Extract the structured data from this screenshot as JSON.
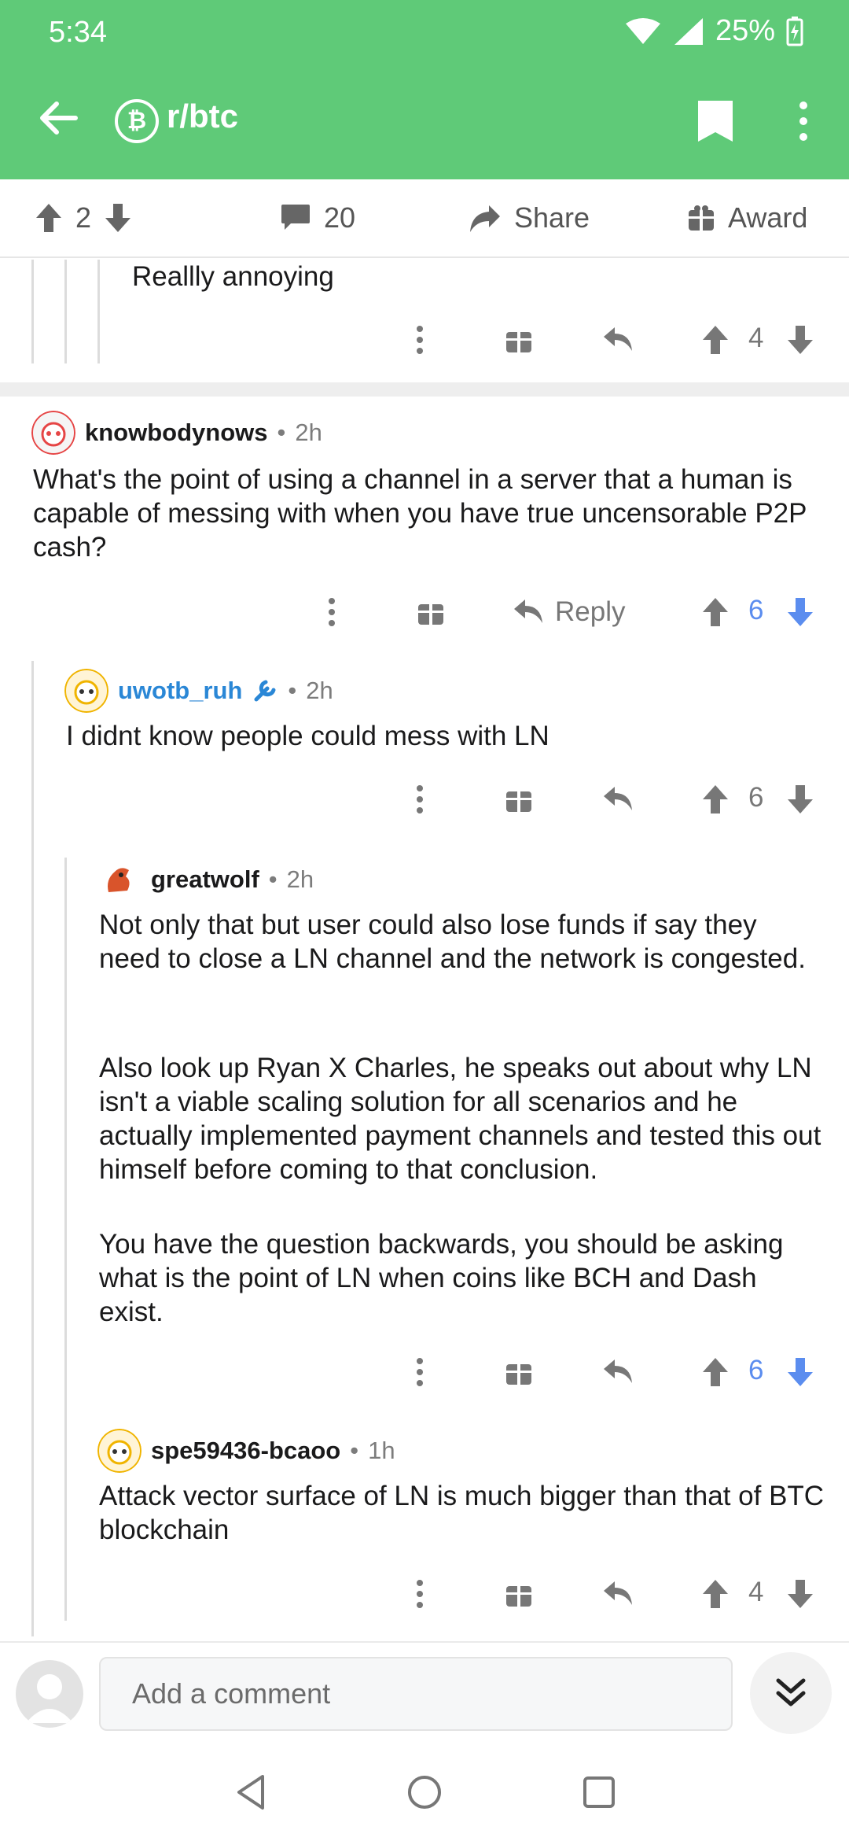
{
  "status": {
    "time": "5:34",
    "battery": "25%"
  },
  "header": {
    "subreddit": "r/btc",
    "sub_icon_glyph": "₿"
  },
  "actionbar": {
    "upvotes": "2",
    "comments": "20",
    "share": "Share",
    "award": "Award"
  },
  "comments": [
    {
      "text": "Reallly annoying",
      "score": "4"
    },
    {
      "author": "knowbodynows",
      "age": "2h",
      "text": "What's the point of using a channel in a server that a human is capable of messing with when you have true uncensorable P2P cash?",
      "reply_label": "Reply",
      "score": "6"
    },
    {
      "author": "uwotb_ruh",
      "age": "2h",
      "text": "I didnt know people could mess with LN",
      "score": "6"
    },
    {
      "author": "greatwolf",
      "age": "2h",
      "paragraphs": [
        "Not only that but user could also lose funds if say they need to close a LN channel and the network is congested.",
        "Also look up Ryan X Charles, he speaks out about why LN isn't a viable scaling solution for all scenarios and he actually implemented payment channels and tested this out himself before coming to that conclusion.",
        "You have the question backwards, you should be asking what is the point of LN when coins like BCH and Dash exist."
      ],
      "score": "6"
    },
    {
      "author": "spe59436-bcaoo",
      "age": "1h",
      "text": "Attack vector surface of LN is much bigger than that of BTC blockchain",
      "score": "4"
    }
  ],
  "bottom": {
    "placeholder": "Add a comment"
  },
  "colors": {
    "header_green": "#5fca78",
    "op_blue": "#2a87d6",
    "vote_blue": "#5b8def"
  }
}
